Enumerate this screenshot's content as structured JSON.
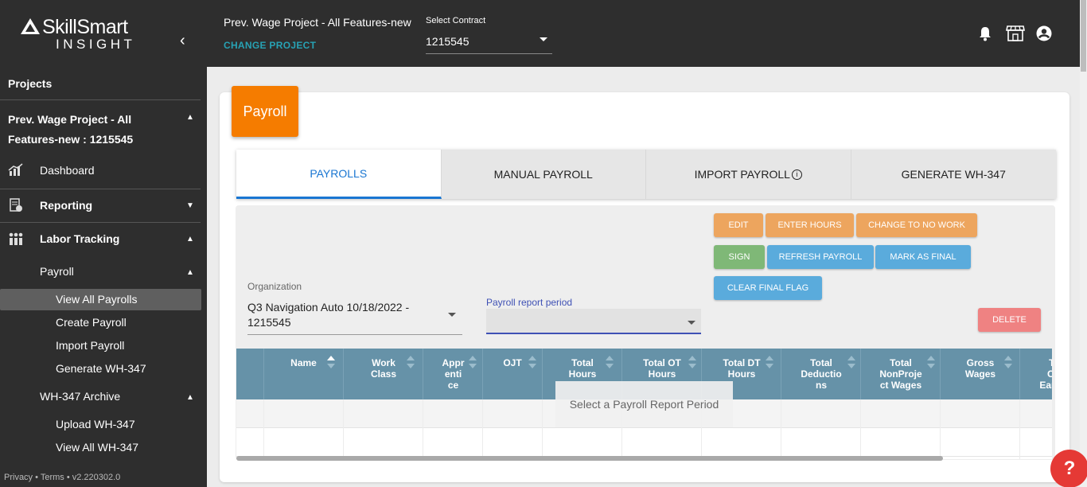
{
  "brand": {
    "name": "SkillSmart",
    "sub": "INSIGHT"
  },
  "sidebar": {
    "projects_heading": "Projects",
    "project_name": "Prev. Wage Project - All Features-new : 1215545",
    "items": {
      "dashboard": "Dashboard",
      "reporting": "Reporting",
      "labor_tracking": "Labor Tracking",
      "payroll": "Payroll",
      "view_all_payrolls": "View All Payrolls",
      "create_payroll": "Create Payroll",
      "import_payroll": "Import Payroll",
      "generate_wh347": "Generate WH-347",
      "wh347_archive": "WH-347 Archive",
      "upload_wh347": "Upload WH-347",
      "view_all_wh347": "View All WH-347"
    },
    "footer": "Privacy • Terms • v2.220302.0"
  },
  "topbar": {
    "project_title": "Prev. Wage Project - All Features-new",
    "change_project": "CHANGE PROJECT",
    "contract_label": "Select Contract",
    "contract_value": "1215545"
  },
  "main": {
    "badge": "Payroll",
    "tabs": [
      "PAYROLLS",
      "MANUAL PAYROLL",
      "IMPORT PAYROLL",
      "GENERATE WH-347"
    ],
    "buttons": {
      "edit": "EDIT",
      "enter_hours": "ENTER HOURS",
      "change_no_work": "CHANGE TO NO WORK",
      "sign": "SIGN",
      "refresh": "REFRESH PAYROLL",
      "mark_final": "MARK AS FINAL",
      "clear_final": "CLEAR FINAL FLAG",
      "delete": "DELETE"
    },
    "organization_label": "Organization",
    "organization_value": "Q3 Navigation Auto 10/18/2022 - 1215545",
    "period_label": "Payroll report period",
    "table_headers": [
      "Name",
      "Work Class",
      "Apprentice",
      "OJT",
      "Total Hours",
      "Total OT Hours",
      "Total DT Hours",
      "Total Deductions",
      "Total NonProject Wages",
      "Gross Wages",
      "Total Other Earnings"
    ],
    "empty_message": "Select a Payroll Report Period"
  },
  "colors": {
    "accent": "#f57c00",
    "tab_active": "#1976d2",
    "header": "#6692a8"
  }
}
